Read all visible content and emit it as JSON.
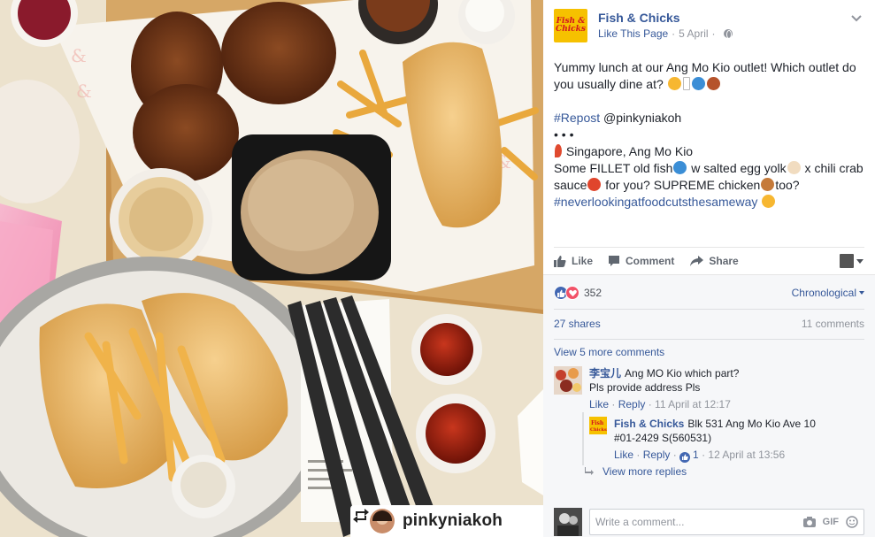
{
  "photo": {
    "credit_name": "pinkyniakoh"
  },
  "page": {
    "name": "Fish & Chicks",
    "logo_line1": "Fish &",
    "logo_line2": "Chicks",
    "like_label": "Like This Page",
    "date": "5 April"
  },
  "post": {
    "line1": "Yummy lunch at our Ang Mo Kio outlet! Which outlet do you usually dine at?",
    "repost_tag": "#Repost",
    "repost_user": "@pinkyniakoh",
    "dots": "• • •",
    "location": "Singapore, Ang Mo Kio",
    "body1": "Some FILLET old fish",
    "body2": " w salted egg yolk",
    "body3": " x chili crab sauce",
    "body4": " for you? SUPREME chicken",
    "body5": "too?",
    "hashtag": "#neverlookingatfoodcutsthesameway"
  },
  "actions": {
    "like": "Like",
    "comment": "Comment",
    "share": "Share"
  },
  "feedback": {
    "reaction_count": "352",
    "sort": "Chronological",
    "shares": "27 shares",
    "comments": "11 comments",
    "view_more": "View 5 more comments",
    "view_more_replies": "View more replies",
    "write_placeholder": "Write a comment..."
  },
  "comments": [
    {
      "name": "李宝儿",
      "text1": "Ang MO Kio which part?",
      "text2": "Pls provide address Pls",
      "like": "Like",
      "reply": "Reply",
      "time": "11 April at 12:17"
    },
    {
      "name": "Fish & Chicks",
      "text1": "Blk 531 Ang Mo Kio Ave 10",
      "text2": "#01-2429 S(560531)",
      "like": "Like",
      "reply": "Reply",
      "likes": "1",
      "time": "12 April at 13:56"
    }
  ],
  "colors": {
    "link": "#365899",
    "brand_yellow": "#f6c100",
    "brand_red": "#d3151e",
    "like_blue": "#4267b2",
    "love_red": "#f25268"
  }
}
